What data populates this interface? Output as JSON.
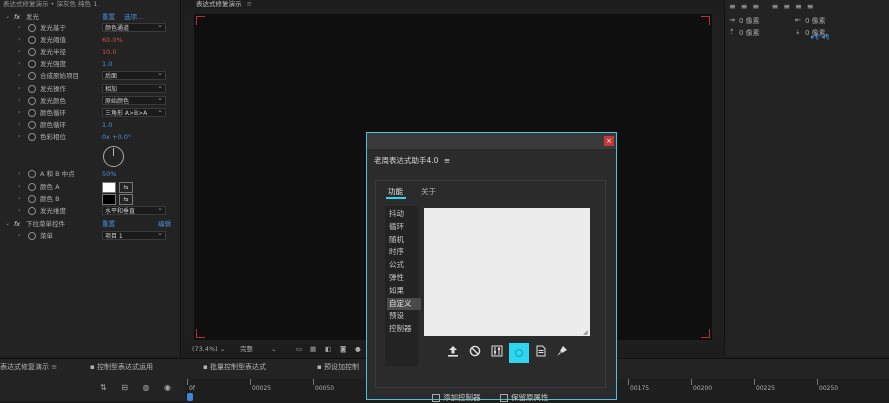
{
  "effect_controls": {
    "title": "表达式修复演示 • 深灰色 纯色 1",
    "rows": [
      {
        "indent": 0,
        "label": "发光",
        "value": "重置",
        "value2": "选项...",
        "kind": "fx"
      },
      {
        "indent": 1,
        "label": "发光基于",
        "value": "颜色通道",
        "kind": "dropdown"
      },
      {
        "indent": 1,
        "label": "发光阈值",
        "value": "60.0%",
        "kind": "red"
      },
      {
        "indent": 1,
        "label": "发光半径",
        "value": "10.0",
        "kind": "red"
      },
      {
        "indent": 1,
        "label": "发光强度",
        "value": "1.0",
        "kind": "blue"
      },
      {
        "indent": 1,
        "label": "合成原始项目",
        "value": "后面",
        "kind": "dropdown"
      },
      {
        "indent": 1,
        "label": "发光操作",
        "value": "相加",
        "kind": "dropdown"
      },
      {
        "indent": 1,
        "label": "发光颜色",
        "value": "原始颜色",
        "kind": "dropdown"
      },
      {
        "indent": 1,
        "label": "颜色循环",
        "value": "三角形 A>B>A",
        "kind": "dropdown"
      },
      {
        "indent": 1,
        "label": "颜色循环",
        "value": "1.0",
        "kind": "blue"
      },
      {
        "indent": 1,
        "label": "色彩相位",
        "value": "0x +0.0°",
        "kind": "blue"
      },
      {
        "indent": 1,
        "label": "A 和 B 中点",
        "value": "50%",
        "kind": "blue"
      },
      {
        "indent": 1,
        "label": "颜色 A",
        "value": "",
        "kind": "swatch-white"
      },
      {
        "indent": 1,
        "label": "颜色 B",
        "value": "",
        "kind": "swatch-black"
      },
      {
        "indent": 1,
        "label": "发光维度",
        "value": "水平和垂直",
        "kind": "dropdown"
      },
      {
        "indent": 0,
        "label": "下拉菜单控件",
        "value": "重置",
        "value2": "编辑",
        "kind": "fx"
      },
      {
        "indent": 1,
        "label": "菜单",
        "value": "项目 1",
        "kind": "dropdown"
      }
    ]
  },
  "viewer": {
    "tab_label": "表达式修复演示",
    "zoom": "(73.4%)",
    "resolution": "完整"
  },
  "right_panel": {
    "values": [
      "0 像素",
      "0 像素",
      "0 像素",
      "0 像素"
    ]
  },
  "timeline": {
    "tabs": [
      "表达式修复演示",
      "控制型表达式运用",
      "批量控制型表达式",
      "预设加控制"
    ],
    "timecodes": [
      "0f",
      "00025",
      "00050",
      "00075",
      "00100",
      "00125",
      "00150",
      "00175",
      "00200",
      "00225",
      "00250"
    ]
  },
  "dialog": {
    "title": "老周表达式助手4.0",
    "tabs": [
      "功能",
      "关于"
    ],
    "side_items": [
      "抖动",
      "循环",
      "随机",
      "时序",
      "公式",
      "弹性",
      "如果",
      "自定义",
      "预设",
      "控制器"
    ],
    "active_item": 7,
    "checkboxes": [
      "添加控制器",
      "保留原属性"
    ],
    "accent": "#2fd6ef",
    "tool_icons": [
      "upload-icon",
      "ban-icon",
      "sliders-icon",
      "loop-icon",
      "document-icon",
      "brush-icon"
    ]
  }
}
